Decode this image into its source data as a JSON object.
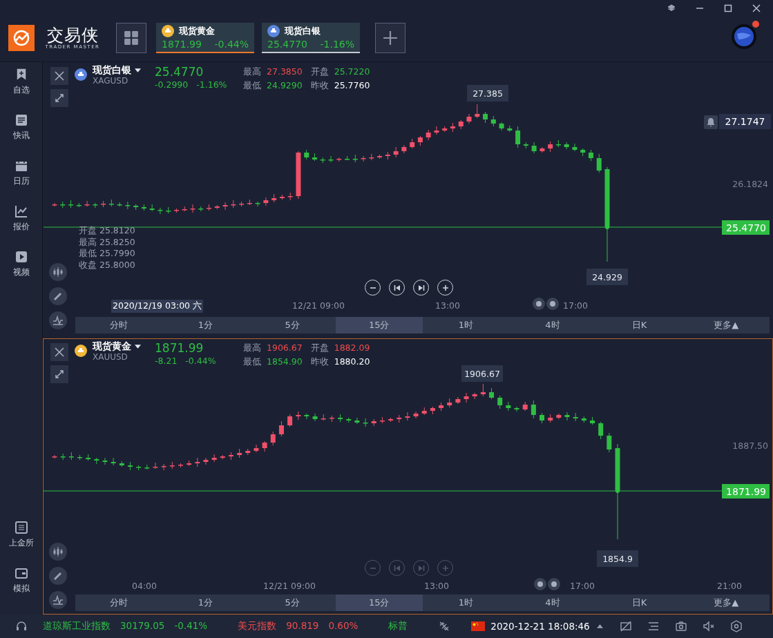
{
  "app": {
    "name": "交易侠",
    "tagline": "TRADER MASTER"
  },
  "quote_tabs": [
    {
      "name": "现货黄金",
      "kind": "gold",
      "price": "1871.99",
      "change": "-0.44%",
      "selected": true
    },
    {
      "name": "现货白银",
      "kind": "silver",
      "price": "25.4770",
      "change": "-1.16%",
      "selected": false
    }
  ],
  "sidebar": {
    "items": [
      {
        "label": "自选"
      },
      {
        "label": "快讯"
      },
      {
        "label": "日历"
      },
      {
        "label": "报价"
      },
      {
        "label": "视频"
      }
    ],
    "bottom_items": [
      {
        "label": "上金所"
      },
      {
        "label": "模拟"
      }
    ]
  },
  "charts": [
    {
      "active": false,
      "kind": "silver",
      "name": "现货白银",
      "symbol": "XAGUSD",
      "rising": false,
      "price": "25.4770",
      "change": "-0.2990",
      "change_pct": "-1.16%",
      "stats": [
        {
          "label": "最高",
          "value": "27.3850",
          "color": "#f04c4c"
        },
        {
          "label": "开盘",
          "value": "25.7220",
          "color": "#2fbe43"
        },
        {
          "label": "最低",
          "value": "24.9290",
          "color": "#2fbe43"
        },
        {
          "label": "昨收",
          "value": "25.7760",
          "color": "#ffffff"
        }
      ],
      "peak_label": "27.385",
      "low_label": "24.929",
      "axis_label": "26.1824",
      "last_price": "25.4770",
      "alert": {
        "price": "27.1747"
      },
      "ohlc_legend": [
        {
          "label": "开盘",
          "value": "25.8120"
        },
        {
          "label": "最高",
          "value": "25.8250"
        },
        {
          "label": "最低",
          "value": "25.7990"
        },
        {
          "label": "收盘",
          "value": "25.8000"
        }
      ],
      "time_axis": [
        {
          "label": "2020/12/19 03:00 六",
          "highlighted": true
        },
        {
          "label": "12/21 09:00",
          "highlighted": false
        },
        {
          "label": "13:00",
          "highlighted": false
        },
        {
          "label": "17:00",
          "highlighted": false
        }
      ],
      "nav_disabled": false,
      "periods": [
        {
          "label": "分时",
          "selected": false
        },
        {
          "label": "1分",
          "selected": false
        },
        {
          "label": "5分",
          "selected": false
        },
        {
          "label": "15分",
          "selected": true
        },
        {
          "label": "1时",
          "selected": false
        },
        {
          "label": "4时",
          "selected": false
        },
        {
          "label": "日K",
          "selected": false
        },
        {
          "label": "更多▲",
          "selected": false
        }
      ]
    },
    {
      "active": true,
      "kind": "gold",
      "name": "现货黄金",
      "symbol": "XAUUSD",
      "rising": false,
      "price": "1871.99",
      "change": "-8.21",
      "change_pct": "-0.44%",
      "stats": [
        {
          "label": "最高",
          "value": "1906.67",
          "color": "#f04c4c"
        },
        {
          "label": "开盘",
          "value": "1882.09",
          "color": "#f04c4c"
        },
        {
          "label": "最低",
          "value": "1854.90",
          "color": "#2fbe43"
        },
        {
          "label": "昨收",
          "value": "1880.20",
          "color": "#ffffff"
        }
      ],
      "peak_label": "1906.67",
      "low_label": "1854.9",
      "axis_label": "1887.50",
      "last_price": "1871.99",
      "time_axis": [
        {
          "label": "04:00",
          "highlighted": false
        },
        {
          "label": "12/21 09:00",
          "highlighted": false
        },
        {
          "label": "13:00",
          "highlighted": false
        },
        {
          "label": "17:00",
          "highlighted": false
        },
        {
          "label": "21:00",
          "highlighted": false
        }
      ],
      "nav_disabled": true,
      "periods": [
        {
          "label": "分时",
          "selected": false
        },
        {
          "label": "1分",
          "selected": false
        },
        {
          "label": "5分",
          "selected": false
        },
        {
          "label": "15分",
          "selected": true
        },
        {
          "label": "1时",
          "selected": false
        },
        {
          "label": "4时",
          "selected": false
        },
        {
          "label": "日K",
          "selected": false
        },
        {
          "label": "更多▲",
          "selected": false
        }
      ]
    }
  ],
  "status_bar": {
    "tickers": [
      {
        "name": "道琼斯工业指数",
        "value": "30179.05",
        "change": "-0.41%",
        "color": "#2fbe43"
      },
      {
        "name": "美元指数",
        "value": "90.819",
        "change": "0.60%",
        "color": "#f04c4c"
      },
      {
        "name": "标普",
        "color": "#2fbe43"
      }
    ],
    "datetime": "2020-12-21 18:08:46"
  }
}
